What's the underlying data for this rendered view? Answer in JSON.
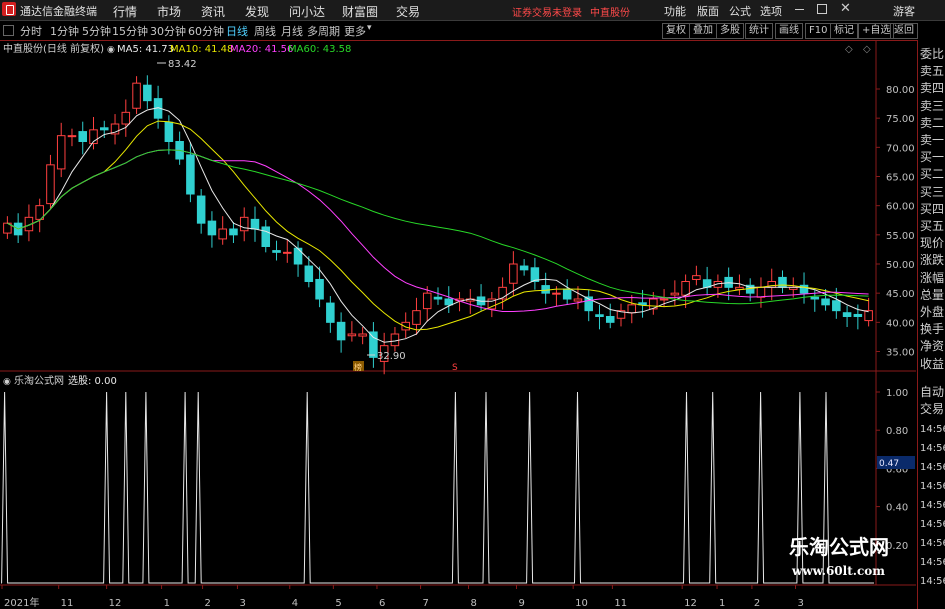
{
  "app": {
    "title": "通达信金融终端"
  },
  "menu": [
    "行情",
    "市场",
    "资讯",
    "发现",
    "问小达",
    "财富圈",
    "交易"
  ],
  "notice": {
    "login": "证券交易未登录",
    "stock": "中直股份"
  },
  "topright": [
    "功能",
    "版面",
    "公式",
    "选项"
  ],
  "user": "游客",
  "window_controls": [
    "minimize-icon",
    "maximize-icon",
    "close-icon"
  ],
  "corner": {
    "top": "R",
    "bottom": "500"
  },
  "timeframes": [
    "分时",
    "1分钟",
    "5分钟",
    "15分钟",
    "30分钟",
    "60分钟",
    "日线",
    "周线",
    "月线",
    "多周期",
    "更多"
  ],
  "active_timeframe": "日线",
  "toolbar_buttons": [
    "复权",
    "叠加",
    "多股",
    "统计",
    "画线",
    "F10",
    "标记",
    "+自选",
    "返回"
  ],
  "main_panel": {
    "title": "中直股份(日线 前复权)",
    "ma": [
      {
        "label": "MA5: 41.73",
        "color": "#e8e8e8"
      },
      {
        "label": "MA10: 41.48",
        "color": "#e8e800"
      },
      {
        "label": "MA20: 41.56",
        "color": "#ff40ff"
      },
      {
        "label": "MA60: 43.58",
        "color": "#28d828"
      }
    ],
    "high_label": "83.42",
    "low_label": "32.90",
    "marker_1": "榜",
    "marker_2": "S"
  },
  "sub_panel": {
    "title": "乐淘公式网",
    "value": "选股: 0.00"
  },
  "sidebar": {
    "quote_labels": [
      "委比",
      "卖五",
      "卖四",
      "卖三",
      "卖二",
      "卖一",
      "买一",
      "买二",
      "买三",
      "买四",
      "买五",
      "现价",
      "涨跌",
      "涨幅",
      "总量",
      "外盘",
      "换手",
      "净资",
      "收益"
    ],
    "trade_labels": [
      "自动",
      "交易"
    ],
    "times": [
      "14:56",
      "14:56",
      "14:56",
      "14:56",
      "14:56",
      "14:56",
      "14:56",
      "14:56",
      "14:56"
    ]
  },
  "watermark": {
    "title": "乐淘公式网",
    "url": "www.60lt.com"
  },
  "chart_data": [
    {
      "type": "candlestick",
      "title": "中直股份(日线 前复权)",
      "y_ticks": [
        "80.00",
        "75.00",
        "70.00",
        "65.00",
        "60.00",
        "55.00",
        "50.00",
        "45.00",
        "40.00",
        "35.00"
      ],
      "ylim": [
        32,
        86
      ],
      "grid": false,
      "x_labels": [
        "2021年",
        "11",
        "12",
        "1",
        "2",
        "3",
        "4",
        "5",
        "6",
        "7",
        "8",
        "9",
        "10",
        "11",
        "12",
        "1",
        "2",
        "3"
      ],
      "x_label_fractions": [
        0.0,
        0.065,
        0.12,
        0.183,
        0.23,
        0.27,
        0.33,
        0.38,
        0.43,
        0.48,
        0.535,
        0.59,
        0.655,
        0.7,
        0.78,
        0.82,
        0.86,
        0.91
      ],
      "close_approx": [
        57,
        55,
        58,
        60,
        67,
        72,
        72,
        71,
        73,
        73,
        74,
        76,
        81,
        78,
        75,
        71,
        68,
        62,
        57,
        55,
        56,
        55,
        58,
        56,
        53,
        52,
        52,
        50,
        47,
        44,
        40,
        37,
        38,
        38,
        34,
        36,
        38,
        40,
        42,
        45,
        44,
        43,
        44,
        44,
        43,
        44,
        46,
        50,
        49,
        47,
        45,
        45,
        44,
        44,
        42,
        41,
        40,
        42,
        43,
        43,
        44,
        44,
        45,
        47,
        48,
        46,
        47,
        46,
        46,
        45,
        46,
        47,
        46,
        46,
        45,
        44,
        43,
        42,
        41,
        41,
        42
      ],
      "series": [
        {
          "name": "MA5",
          "value": 41.73
        },
        {
          "name": "MA10",
          "value": 41.48
        },
        {
          "name": "MA20",
          "value": 41.56
        },
        {
          "name": "MA60",
          "value": 43.58
        }
      ],
      "annotations": [
        {
          "text": "83.42",
          "value": 83.42
        },
        {
          "text": "32.90",
          "value": 32.9
        }
      ]
    },
    {
      "type": "line",
      "title": "乐淘公式网",
      "y_ticks": [
        "1.00",
        "0.80",
        "0.60",
        "0.40",
        "0.20"
      ],
      "ylim": [
        0,
        1
      ],
      "current_value_label": "0.47",
      "signal_fractions": [
        0.003,
        0.12,
        0.142,
        0.165,
        0.21,
        0.225,
        0.35,
        0.52,
        0.555,
        0.605,
        0.66,
        0.785,
        0.815,
        0.87,
        0.915,
        0.945
      ],
      "signal_value": 1.0
    }
  ]
}
